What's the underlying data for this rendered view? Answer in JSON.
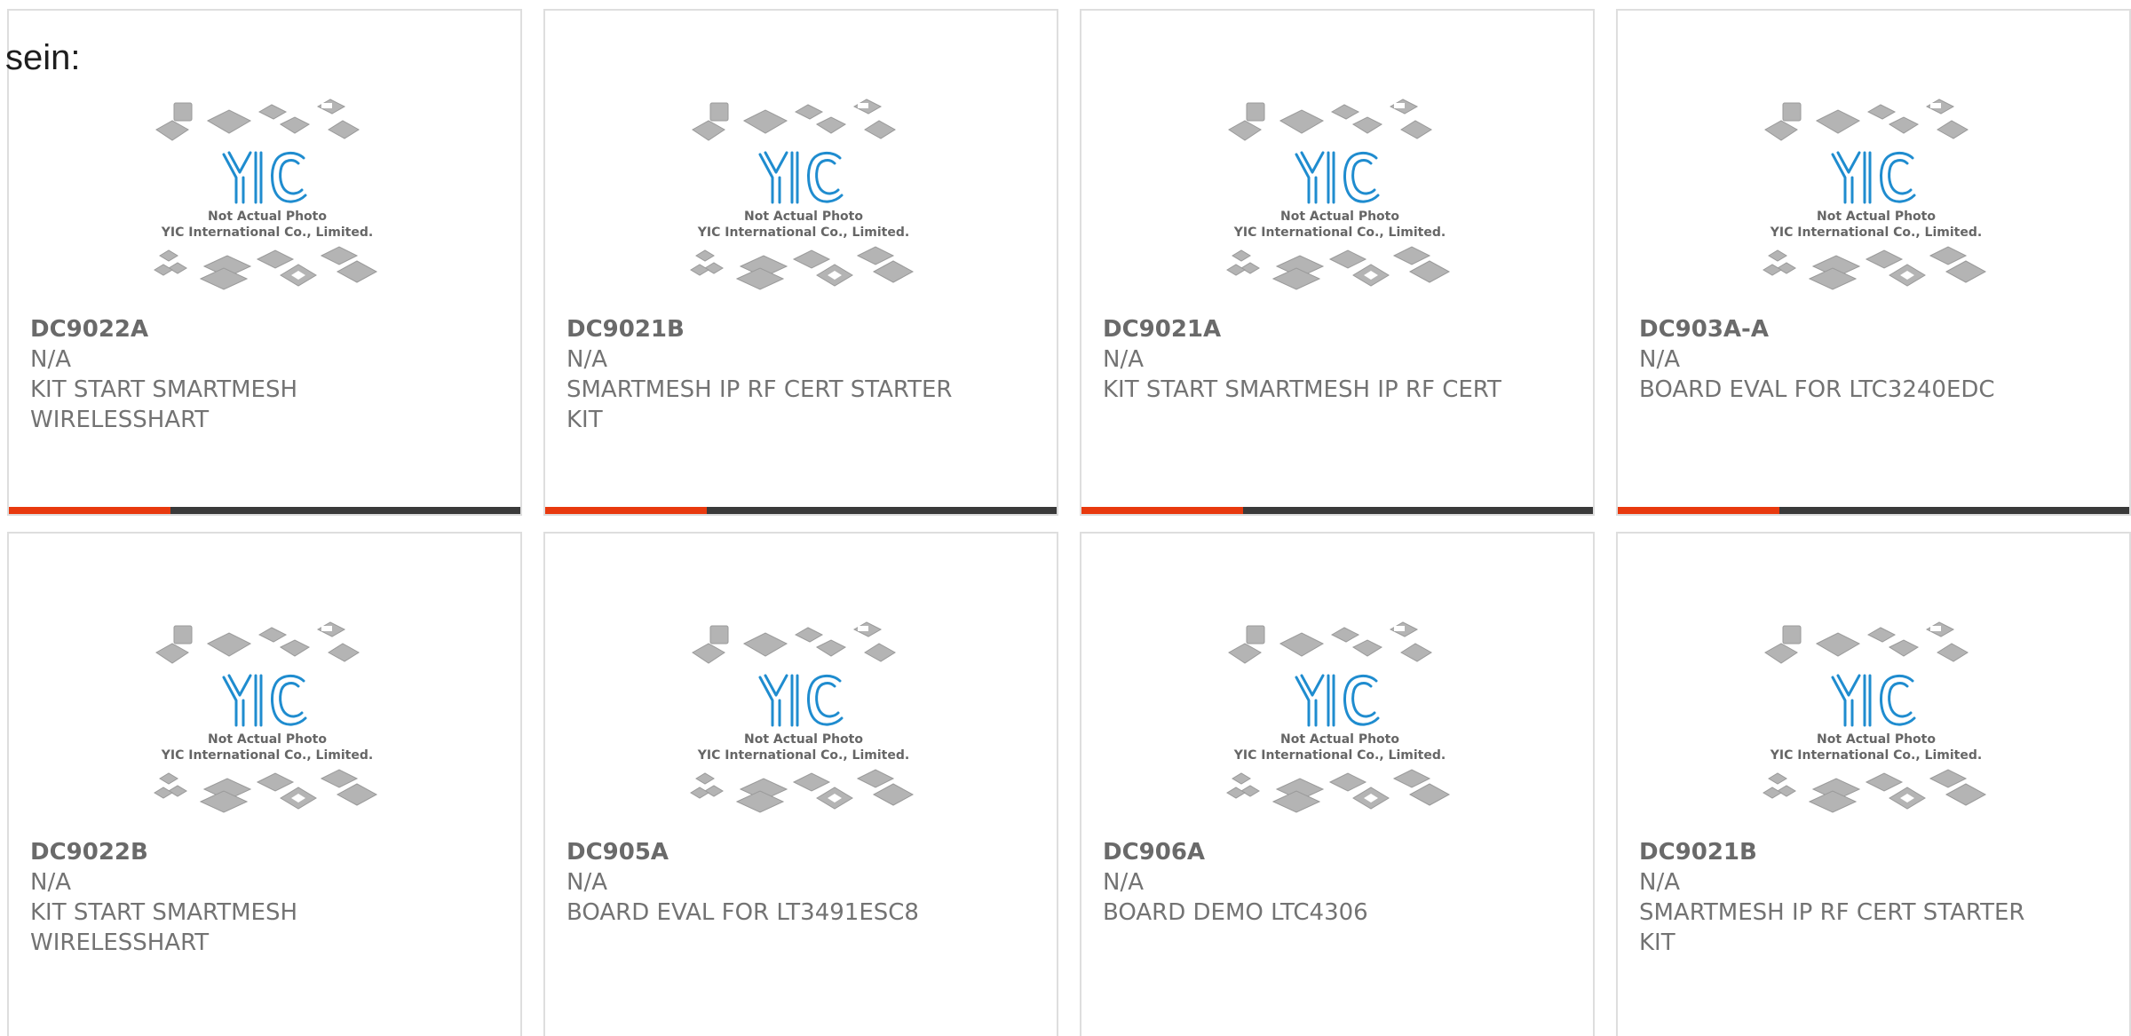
{
  "intro_text": "sein:",
  "placeholder_image": {
    "caption_line1": "Not Actual Photo",
    "caption_line2": "YIC International Co., Limited.",
    "logo_text": "YIC"
  },
  "colors": {
    "accent": "#e8390e",
    "bar": "#3a3a3a",
    "logo_blue": "#1f8ccf"
  },
  "products": [
    {
      "part_number": "DC9022A",
      "manufacturer": "N/A",
      "description": "KIT START SMARTMESH WIRELESSHART"
    },
    {
      "part_number": "DC9021B",
      "manufacturer": "N/A",
      "description": "SMARTMESH IP RF CERT STARTER KIT"
    },
    {
      "part_number": "DC9021A",
      "manufacturer": "N/A",
      "description": "KIT START SMARTMESH IP RF CERT"
    },
    {
      "part_number": "DC903A-A",
      "manufacturer": "N/A",
      "description": "BOARD EVAL FOR LTC3240EDC"
    },
    {
      "part_number": "DC9022B",
      "manufacturer": "N/A",
      "description": "KIT START SMARTMESH WIRELESSHART"
    },
    {
      "part_number": "DC905A",
      "manufacturer": "N/A",
      "description": "BOARD EVAL FOR LT3491ESC8"
    },
    {
      "part_number": "DC906A",
      "manufacturer": "N/A",
      "description": "BOARD DEMO LTC4306"
    },
    {
      "part_number": "DC9021B",
      "manufacturer": "N/A",
      "description": "SMARTMESH IP RF CERT STARTER KIT"
    }
  ]
}
